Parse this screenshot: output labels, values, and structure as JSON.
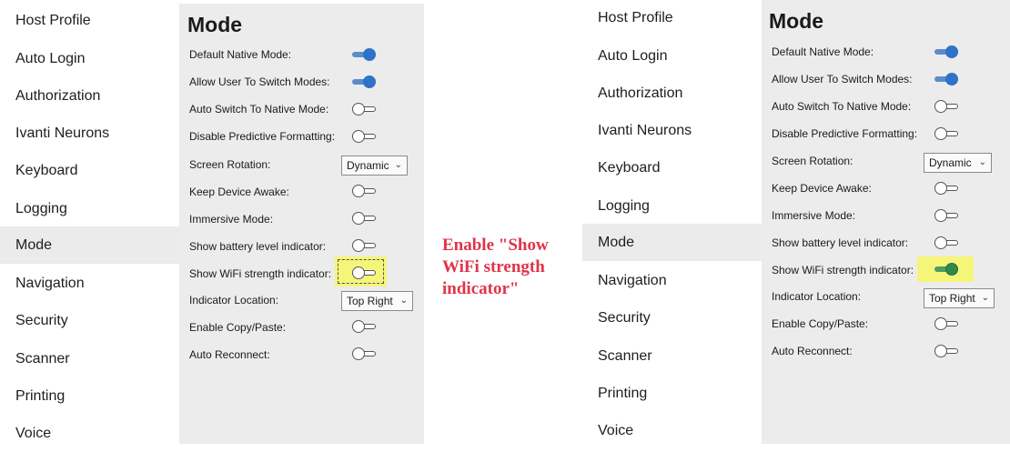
{
  "nav_items": [
    "Host Profile",
    "Auto Login",
    "Authorization",
    "Ivanti Neurons",
    "Keyboard",
    "Logging",
    "Mode",
    "Navigation",
    "Security",
    "Scanner",
    "Printing",
    "Voice"
  ],
  "active_nav": "Mode",
  "mode": {
    "title": "Mode",
    "labels": {
      "default_native_mode": "Default Native Mode:",
      "allow_user_switch": "Allow User To Switch Modes:",
      "auto_switch_native": "Auto Switch To Native Mode:",
      "disable_predictive": "Disable Predictive Formatting:",
      "screen_rotation": "Screen Rotation:",
      "keep_awake": "Keep Device Awake:",
      "immersive": "Immersive Mode:",
      "battery_indicator": "Show battery level indicator:",
      "wifi_indicator": "Show WiFi strength indicator:",
      "indicator_location": "Indicator Location:",
      "copy_paste": "Enable Copy/Paste:",
      "auto_reconnect": "Auto Reconnect:"
    },
    "screen_rotation_value": "Dynamic",
    "indicator_location_value": "Top Right"
  },
  "before": {
    "default_native_mode": true,
    "allow_user_switch": true,
    "auto_switch_native": false,
    "disable_predictive": false,
    "keep_awake": false,
    "immersive": false,
    "battery_indicator": false,
    "wifi_indicator": false,
    "copy_paste": false,
    "auto_reconnect": false
  },
  "after": {
    "default_native_mode": true,
    "allow_user_switch": true,
    "auto_switch_native": false,
    "disable_predictive": false,
    "keep_awake": false,
    "immersive": false,
    "battery_indicator": false,
    "wifi_indicator": true,
    "copy_paste": false,
    "auto_reconnect": false
  },
  "annotation": "Enable \"Show WiFi strength indicator\"",
  "colors": {
    "toggle_on": "#2f73c8",
    "toggle_on_highlighted": "#2e8a4a",
    "highlight": "#f5f57a",
    "annotation": "#e0344a"
  }
}
